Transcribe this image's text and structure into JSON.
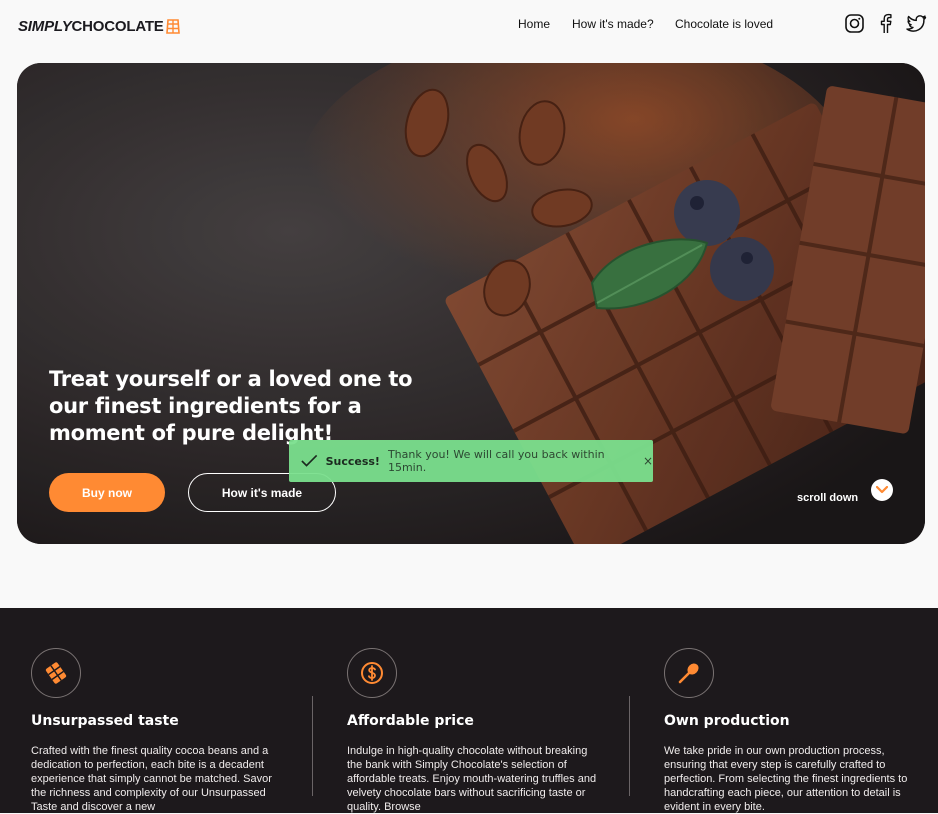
{
  "header": {
    "logo_bold": "SIMPLY",
    "logo_rest": "CHOCOLATE",
    "nav": [
      "Home",
      "How it's made?",
      "Chocolate is loved"
    ],
    "social": [
      "instagram-icon",
      "facebook-icon",
      "twitter-icon"
    ]
  },
  "hero": {
    "headline": "Treat yourself or a loved one to our finest ingredients for a moment of pure delight!",
    "buy_label": "Buy now",
    "how_label": "How it's made",
    "scroll_label": "scroll down"
  },
  "toast": {
    "title": "Success!",
    "message": "Thank you! We will call you back within 15min.",
    "close": "×"
  },
  "features": [
    {
      "icon": "chocolate-bar-icon",
      "title": "Unsurpassed taste",
      "text": "Crafted with the finest quality cocoa beans and a dedication to perfection, each bite is a decadent experience that simply cannot be matched. Savor the richness and complexity of our Unsurpassed Taste and discover a new"
    },
    {
      "icon": "dollar-coin-icon",
      "title": "Affordable price",
      "text": "Indulge in high-quality chocolate without breaking the bank with Simply Chocolate's selection of affordable treats. Enjoy mouth-watering truffles and velvety chocolate bars without sacrificing taste or quality. Browse"
    },
    {
      "icon": "spoon-icon",
      "title": "Own production",
      "text": "We take pride in our own production process, ensuring that every step is carefully crafted to perfection. From selecting the finest ingredients to handcrafting each piece, our attention to detail is evident in every bite."
    }
  ],
  "colors": {
    "accent": "#ff8a33",
    "dark": "#1d191c",
    "toast": "#7be08e"
  }
}
